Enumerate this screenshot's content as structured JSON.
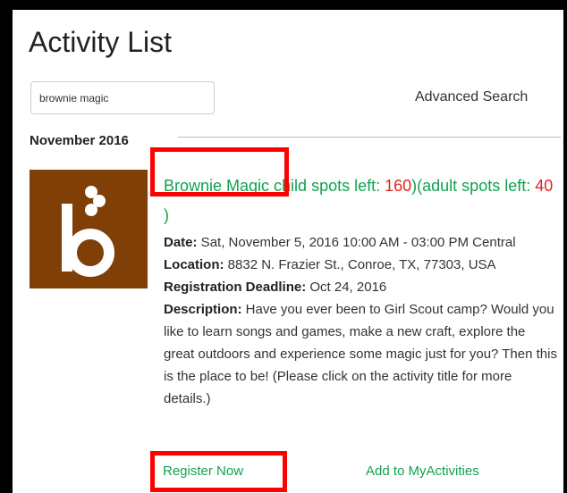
{
  "page": {
    "title": "Activity List"
  },
  "search": {
    "value": "brownie magic",
    "advanced_label": "Advanced Search"
  },
  "month": {
    "label": "November 2016"
  },
  "activity": {
    "thumbnail": {
      "icon": "girl-scouts-b-logo",
      "background": "#7f3f06"
    },
    "title": "Brownie Magic",
    "child_spots_prefix": " child spots left: ",
    "child_spots": "160",
    "adult_spots_prefix": ")(adult spots left: ",
    "adult_spots": "40",
    "adult_spots_suffix": " )",
    "date_label": "Date:",
    "date_value": " Sat, November 5, 2016 10:00 AM - 03:00 PM Central",
    "location_label": "Location:",
    "location_value": " 8832 N. Frazier St., Conroe, TX, 77303, USA",
    "deadline_label": "Registration Deadline:",
    "deadline_value": " Oct 24, 2016",
    "description_label": "Description:",
    "description_value": " Have you ever been to Girl Scout camp? Would you like to learn songs and games, make a new craft, explore the great outdoors and experience some magic just for you? Then this is the place to be! (Please click on the activity title for more details.)",
    "register_label": "Register Now",
    "myactivities_label": "Add to MyActivities"
  },
  "colors": {
    "link_green": "#12a150",
    "count_red": "#e52222",
    "highlight_box": "#ff0000",
    "frame": "#000000"
  }
}
